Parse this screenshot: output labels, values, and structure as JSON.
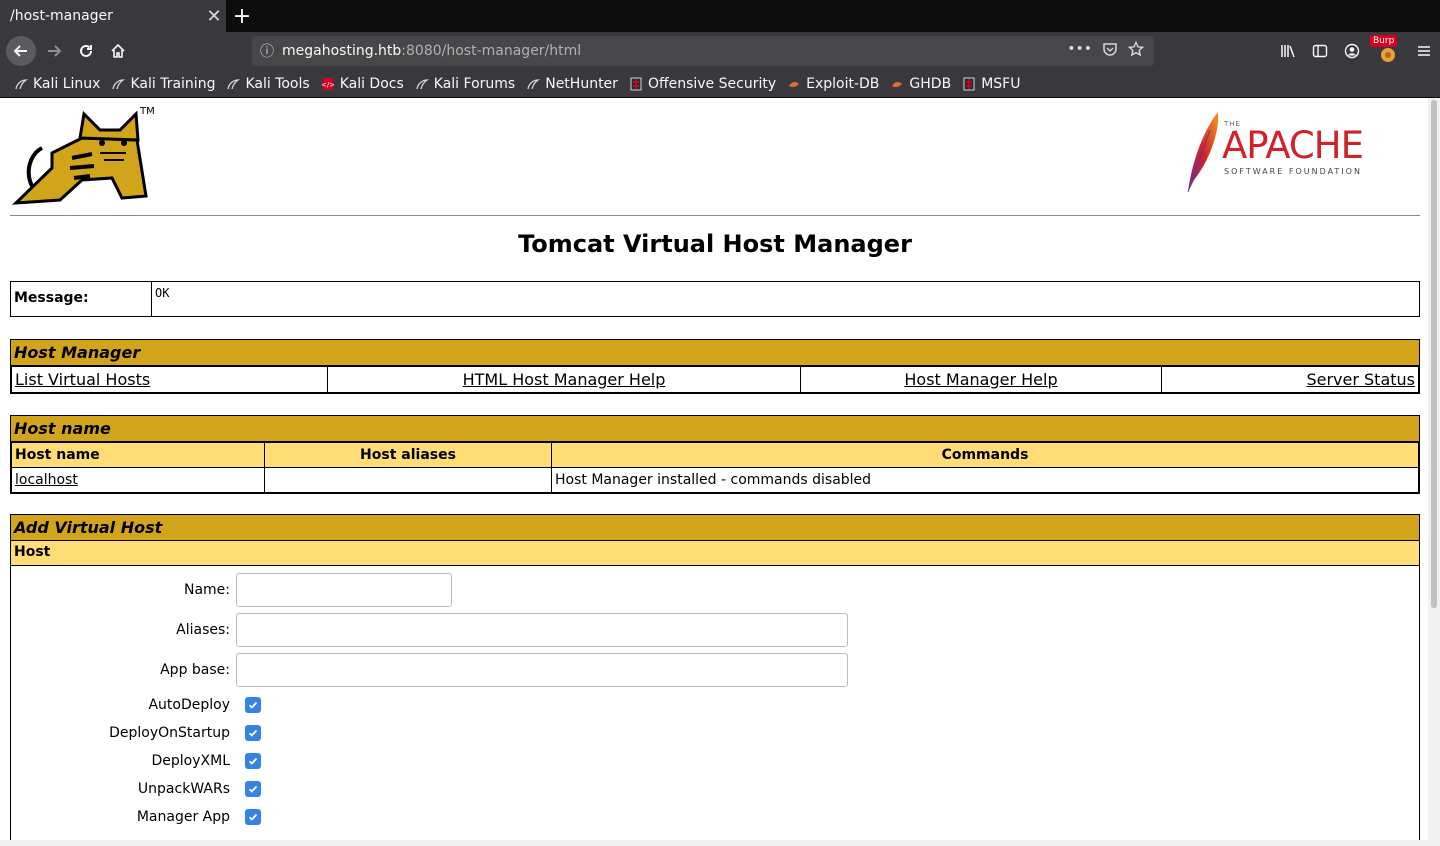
{
  "browser": {
    "tab_title": "/host-manager",
    "tab_close": "✕",
    "new_tab": "+",
    "url_host": "megahosting.htb",
    "url_path": ":8080/host-manager/html",
    "burp_label": "Burp",
    "bookmarks": [
      {
        "label": "Kali Linux",
        "icon": "kali-dragon-icon"
      },
      {
        "label": "Kali Training",
        "icon": "kali-dragon-icon"
      },
      {
        "label": "Kali Tools",
        "icon": "kali-dragon-icon"
      },
      {
        "label": "Kali Docs",
        "icon": "docs-icon"
      },
      {
        "label": "Kali Forums",
        "icon": "kali-dragon-icon"
      },
      {
        "label": "NetHunter",
        "icon": "kali-dragon-icon"
      },
      {
        "label": "Offensive Security",
        "icon": "offsec-icon"
      },
      {
        "label": "Exploit-DB",
        "icon": "exploitdb-icon"
      },
      {
        "label": "GHDB",
        "icon": "exploitdb-icon"
      },
      {
        "label": "MSFU",
        "icon": "offsec-icon"
      }
    ]
  },
  "page": {
    "tomcat_tm": "TM",
    "apache": {
      "the": "THE",
      "name": "APACHE",
      "sub": "SOFTWARE FOUNDATION"
    },
    "title": "Tomcat Virtual Host Manager",
    "message_label": "Message:",
    "message_value": "OK",
    "host_manager": {
      "title": "Host Manager",
      "links": [
        "List Virtual Hosts",
        "HTML Host Manager Help",
        "Host Manager Help",
        "Server Status"
      ]
    },
    "host_name_section": {
      "title": "Host name",
      "columns": [
        "Host name",
        "Host aliases",
        "Commands"
      ],
      "rows": [
        {
          "name": "localhost",
          "aliases": "",
          "commands": "Host Manager installed - commands disabled"
        }
      ]
    },
    "add_host": {
      "title": "Add Virtual Host",
      "subtitle": "Host",
      "fields": {
        "name": "Name:",
        "aliases": "Aliases:",
        "appbase": "App base:"
      },
      "checkboxes": [
        "AutoDeploy",
        "DeployOnStartup",
        "DeployXML",
        "UnpackWARs",
        "Manager App"
      ]
    }
  }
}
